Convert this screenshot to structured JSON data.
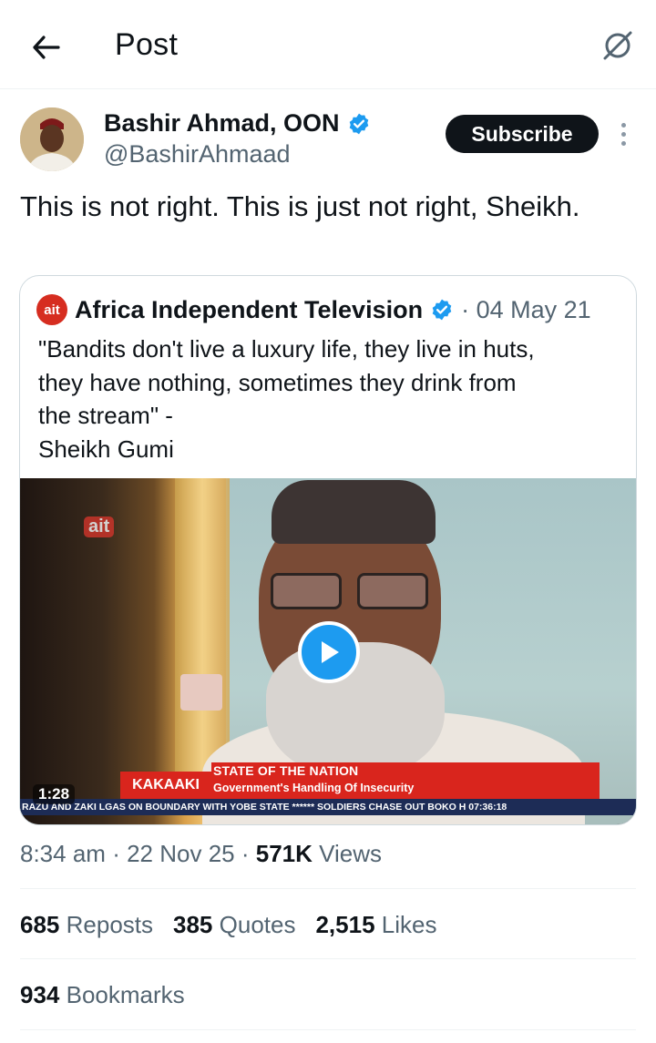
{
  "header": {
    "title": "Post",
    "back_icon": "arrow-left-icon",
    "grok_icon": "grok-icon"
  },
  "author": {
    "name": "Bashir Ahmad, OON",
    "handle": "@BashirAhmaad",
    "verified": true,
    "subscribe_label": "Subscribe"
  },
  "post": {
    "text": "This is not right. This is just not right, Sheikh."
  },
  "quote": {
    "logo_text": "ait",
    "name": "Africa Independent Television",
    "verified": true,
    "date": "· 04 May 21",
    "text_lines": [
      "\"Bandits don't live a luxury life, they live in huts,",
      "they have nothing, sometimes they drink from",
      "the stream\" -",
      "Sheikh Gumi"
    ],
    "video": {
      "duration": "1:28",
      "channel_logo": "ait",
      "show_label": "KAKAAKI",
      "band_title": "STATE OF THE NATION",
      "band_subtitle": "Government's Handling Of Insecurity",
      "ticker": "RAZU AND ZAKI LGAS ON BOUNDARY WITH YOBE STATE ****** SOLDIERS CHASE OUT BOKO H 07:36:18"
    }
  },
  "meta": {
    "time": "8:34 am",
    "sep1": "·",
    "date": "22 Nov 25",
    "sep2": "·",
    "views_count": "571K",
    "views_label": "Views"
  },
  "stats": {
    "reposts_count": "685",
    "reposts_label": "Reposts",
    "quotes_count": "385",
    "quotes_label": "Quotes",
    "likes_count": "2,515",
    "likes_label": "Likes",
    "bookmarks_count": "934",
    "bookmarks_label": "Bookmarks"
  },
  "colors": {
    "accent": "#1d9bf0",
    "text": "#0f1419",
    "muted": "#536471",
    "border": "#cfd9de"
  }
}
